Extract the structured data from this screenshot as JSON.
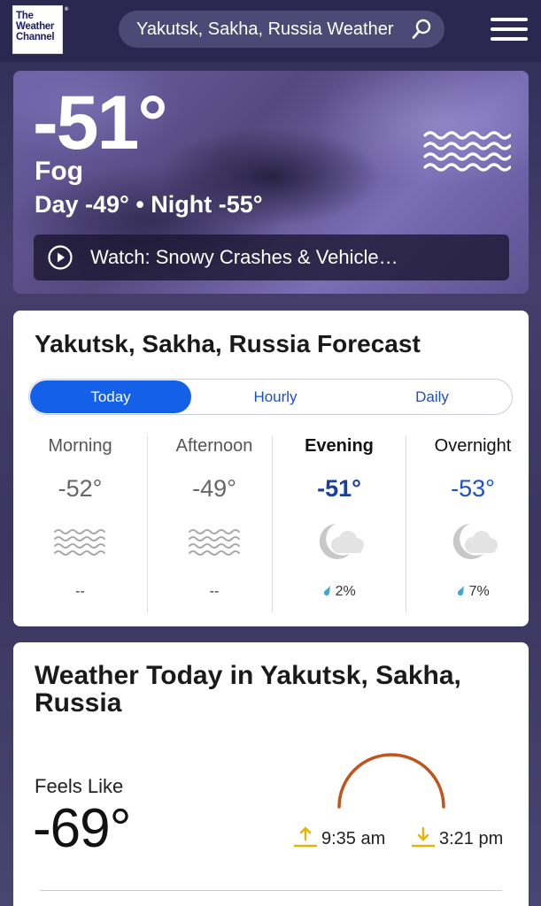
{
  "header": {
    "logo_text": "The Weather Channel",
    "search_text": "Yakutsk, Sakha, Russia Weather"
  },
  "hero": {
    "temperature": "-51°",
    "condition": "Fog",
    "day_night": "Day -49° • Night -55°",
    "watch_label": "Watch:  Snowy Crashes & Vehicle…"
  },
  "forecast": {
    "title": "Yakutsk, Sakha, Russia Forecast",
    "tabs": [
      "Today",
      "Hourly",
      "Daily"
    ],
    "periods": [
      {
        "name": "Morning",
        "temp": "-52°",
        "icon": "fog-icon",
        "precip": "--"
      },
      {
        "name": "Afternoon",
        "temp": "-49°",
        "icon": "fog-icon",
        "precip": "--"
      },
      {
        "name": "Evening",
        "temp": "-51°",
        "icon": "cloudy-night-icon",
        "precip": "2%"
      },
      {
        "name": "Overnight",
        "temp": "-53°",
        "icon": "cloudy-night-icon",
        "precip": "7%"
      }
    ]
  },
  "today": {
    "title": "Weather Today in Yakutsk, Sakha, Russia",
    "feels_like_label": "Feels Like",
    "feels_like_value": "-69°",
    "sunrise": "9:35 am",
    "sunset": "3:21 pm"
  },
  "colors": {
    "accent_blue": "#1560e8",
    "sun_arc": "#c0541a",
    "sun_marker": "#e8b400"
  }
}
